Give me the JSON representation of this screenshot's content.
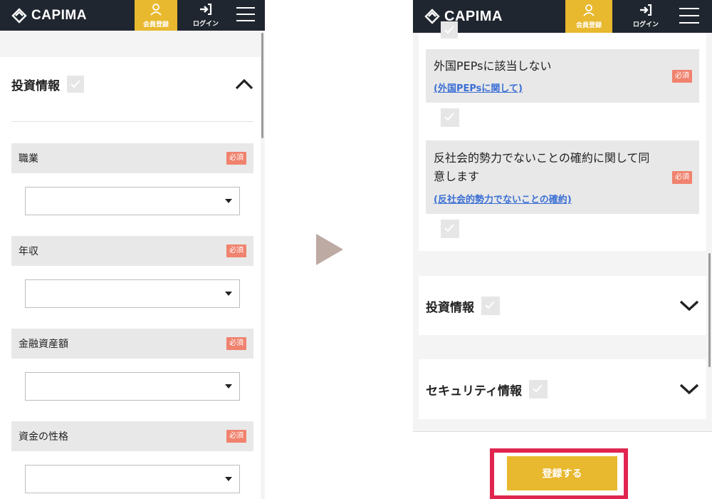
{
  "header": {
    "brand": "CAPIMA",
    "member_label": "会員登録",
    "login_label": "ログイン"
  },
  "left": {
    "section_title": "投資情報",
    "fields": [
      {
        "label": "職業",
        "required": "必須",
        "value": ""
      },
      {
        "label": "年収",
        "required": "必須",
        "value": ""
      },
      {
        "label": "金融資産額",
        "required": "必須",
        "value": ""
      },
      {
        "label": "資金の性格",
        "required": "必須",
        "value": ""
      }
    ]
  },
  "right": {
    "agreements": [
      {
        "text": "外国PEPsに該当しない",
        "link": "(外国PEPsに関して)",
        "required": "必須"
      },
      {
        "text_line1": "反社会的勢力でないことの確約に関して同",
        "text_line2": "意します",
        "link": "(反社会的勢力でないことの確約)",
        "required": "必須"
      }
    ],
    "sections": [
      {
        "title": "投資情報"
      },
      {
        "title": "セキュリティ情報"
      }
    ],
    "submit_label": "登録する"
  },
  "colors": {
    "header_bg": "#20262f",
    "accent_yellow": "#e8b82e",
    "required_badge": "#f0826e",
    "highlight_frame": "#e0254f",
    "link": "#3b6fd4"
  }
}
